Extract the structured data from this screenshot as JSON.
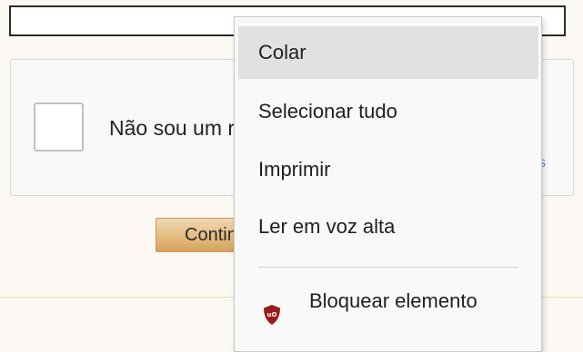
{
  "page": {
    "input_value": "",
    "captcha_label": "Não sou um robô",
    "captcha_logo_hint": "s",
    "continue_label": "Continuar"
  },
  "context_menu": {
    "items": [
      {
        "label": "Colar",
        "highlighted": true
      },
      {
        "label": "Selecionar tudo",
        "highlighted": false
      },
      {
        "label": "Imprimir",
        "highlighted": false
      },
      {
        "label": "Ler em voz alta",
        "highlighted": false
      },
      {
        "label": "Bloquear elemento",
        "icon": "ublock-shield-icon",
        "highlighted": false
      }
    ]
  },
  "colors": {
    "page_background": "#fcf9f4",
    "menu_background": "#f9f9f9",
    "menu_highlight": "#e1e1e1",
    "ublock_red": "#9b1b1b",
    "button_tan": "#e2b97c"
  }
}
